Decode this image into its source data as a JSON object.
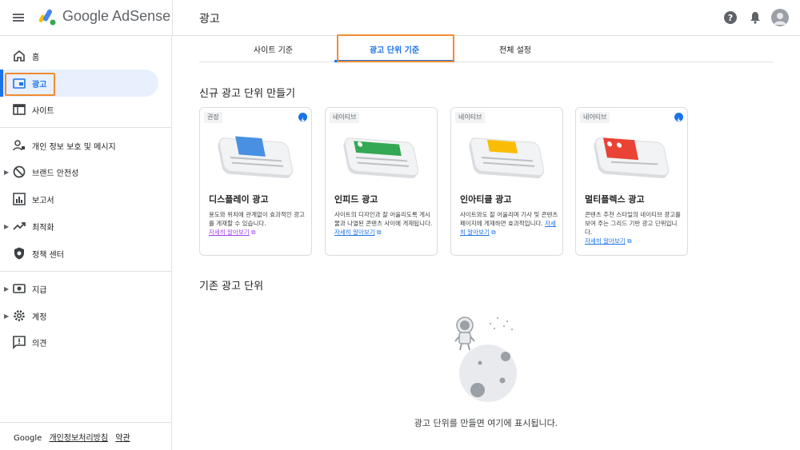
{
  "header": {
    "brand_prefix": "Google",
    "brand_suffix": "AdSense",
    "page_title": "광고"
  },
  "sidebar": {
    "items": [
      {
        "label": "홈",
        "icon": "home-icon"
      },
      {
        "label": "광고",
        "icon": "ads-icon",
        "active": true
      },
      {
        "label": "사이트",
        "icon": "sites-icon"
      },
      {
        "label": "개인 정보 보호 및 메시지",
        "icon": "privacy-icon"
      },
      {
        "label": "브랜드 안전성",
        "icon": "block-icon",
        "expandable": true
      },
      {
        "label": "보고서",
        "icon": "reports-icon"
      },
      {
        "label": "최적화",
        "icon": "trend-icon",
        "expandable": true
      },
      {
        "label": "정책 센터",
        "icon": "shield-icon"
      },
      {
        "label": "지급",
        "icon": "payments-icon",
        "expandable": true
      },
      {
        "label": "계정",
        "icon": "gear-icon",
        "expandable": true
      },
      {
        "label": "의견",
        "icon": "feedback-icon"
      }
    ],
    "footer": {
      "google": "Google",
      "privacy": "개인정보처리방침",
      "terms": "약관"
    }
  },
  "tabs": [
    {
      "label": "사이트 기준"
    },
    {
      "label": "광고 단위 기준",
      "active": true
    },
    {
      "label": "전체 설정"
    }
  ],
  "new_section": {
    "title": "신규 광고 단위 만들기",
    "cards": [
      {
        "badge": "권장",
        "title": "디스플레이 광고",
        "desc": "용도와 위치에 관계없이 효과적인 광고를 게재할 수 있습니다.",
        "link": "자세히 알아보기",
        "bolt": true,
        "accent": "#4a90e2"
      },
      {
        "badge": "네이티브",
        "title": "인피드 광고",
        "desc": "사이트의 디자인과 잘 어울리도록 게시물과 나열된 콘텐츠 사이에 게재됩니다.",
        "link": "자세히 알아보기",
        "bolt": false,
        "accent": "#34a853"
      },
      {
        "badge": "네이티브",
        "title": "인아티클 광고",
        "desc": "사이트와도 잘 어울리며 기사 및 콘텐츠 페이지에 게재하면 효과적입니다.",
        "link": "자세히 알아보기",
        "bolt": false,
        "accent": "#fbbc04"
      },
      {
        "badge": "네이티브",
        "title": "멀티플렉스 광고",
        "desc": "콘텐츠 추천 스타일의 네이티브 광고를 보여 주는 그리드 기반 광고 단위입니다.",
        "link": "자세히 알아보기",
        "bolt": true,
        "accent": "#ea4335"
      }
    ]
  },
  "existing_section": {
    "title": "기존 광고 단위",
    "empty_text": "광고 단위를 만들면 여기에 표시됩니다."
  },
  "colors": {
    "accent": "#1a73e8",
    "highlight": "#f28b30"
  }
}
